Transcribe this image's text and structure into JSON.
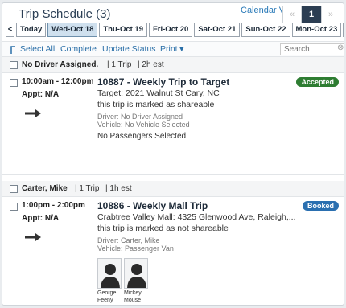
{
  "header": {
    "title": "Trip Schedule (3)",
    "calendar_link": "Calendar View",
    "pager": {
      "prev": "«",
      "current": "1",
      "next": "»"
    }
  },
  "daybar": {
    "prev": "<",
    "next": ">",
    "days": [
      "Today",
      "Wed-Oct 18",
      "Thu-Oct 19",
      "Fri-Oct 20",
      "Sat-Oct 21",
      "Sun-Oct 22",
      "Mon-Oct 23"
    ],
    "selected": "Wed-Oct 18"
  },
  "toolbar": {
    "select_all": "Select All",
    "complete": "Complete",
    "update_status": "Update Status",
    "print": "Print▼",
    "search_placeholder": "Search",
    "clear": "⊗"
  },
  "groups": [
    {
      "name": "No Driver Assigned.",
      "trips": "1 Trip",
      "est": "2h est"
    },
    {
      "name": "Carter, Mike",
      "trips": "1 Trip",
      "est": "1h est"
    }
  ],
  "trips": [
    {
      "time": "10:00am - 12:00pm",
      "appt": "Appt: N/A",
      "name": "10887 - Weekly Trip to Target",
      "destination": "Target: 2021 Walnut St Cary, NC",
      "shareable": "this trip is marked as shareable",
      "driver": "Driver: No Driver Assigned",
      "vehicle": "Vehicle: No Vehicle Selected",
      "passengers_note": "No Passengers Selected",
      "status": "Accepted",
      "status_color": "#2e7d32"
    },
    {
      "time": "1:00pm - 2:00pm",
      "appt": "Appt: N/A",
      "name": "10886 - Weekly Mall Trip",
      "destination": "Crabtree Valley Mall: 4325 Glenwood Ave, Raleigh,...",
      "shareable": "this trip is marked as not shareable",
      "driver": "Driver: Carter, Mike",
      "vehicle": "Vehicle: Passenger Van",
      "status": "Booked",
      "status_color": "#2a6fb0",
      "passengers": [
        {
          "first": "George",
          "last": "Feeny"
        },
        {
          "first": "Mickey",
          "last": "Mouse"
        }
      ]
    }
  ]
}
